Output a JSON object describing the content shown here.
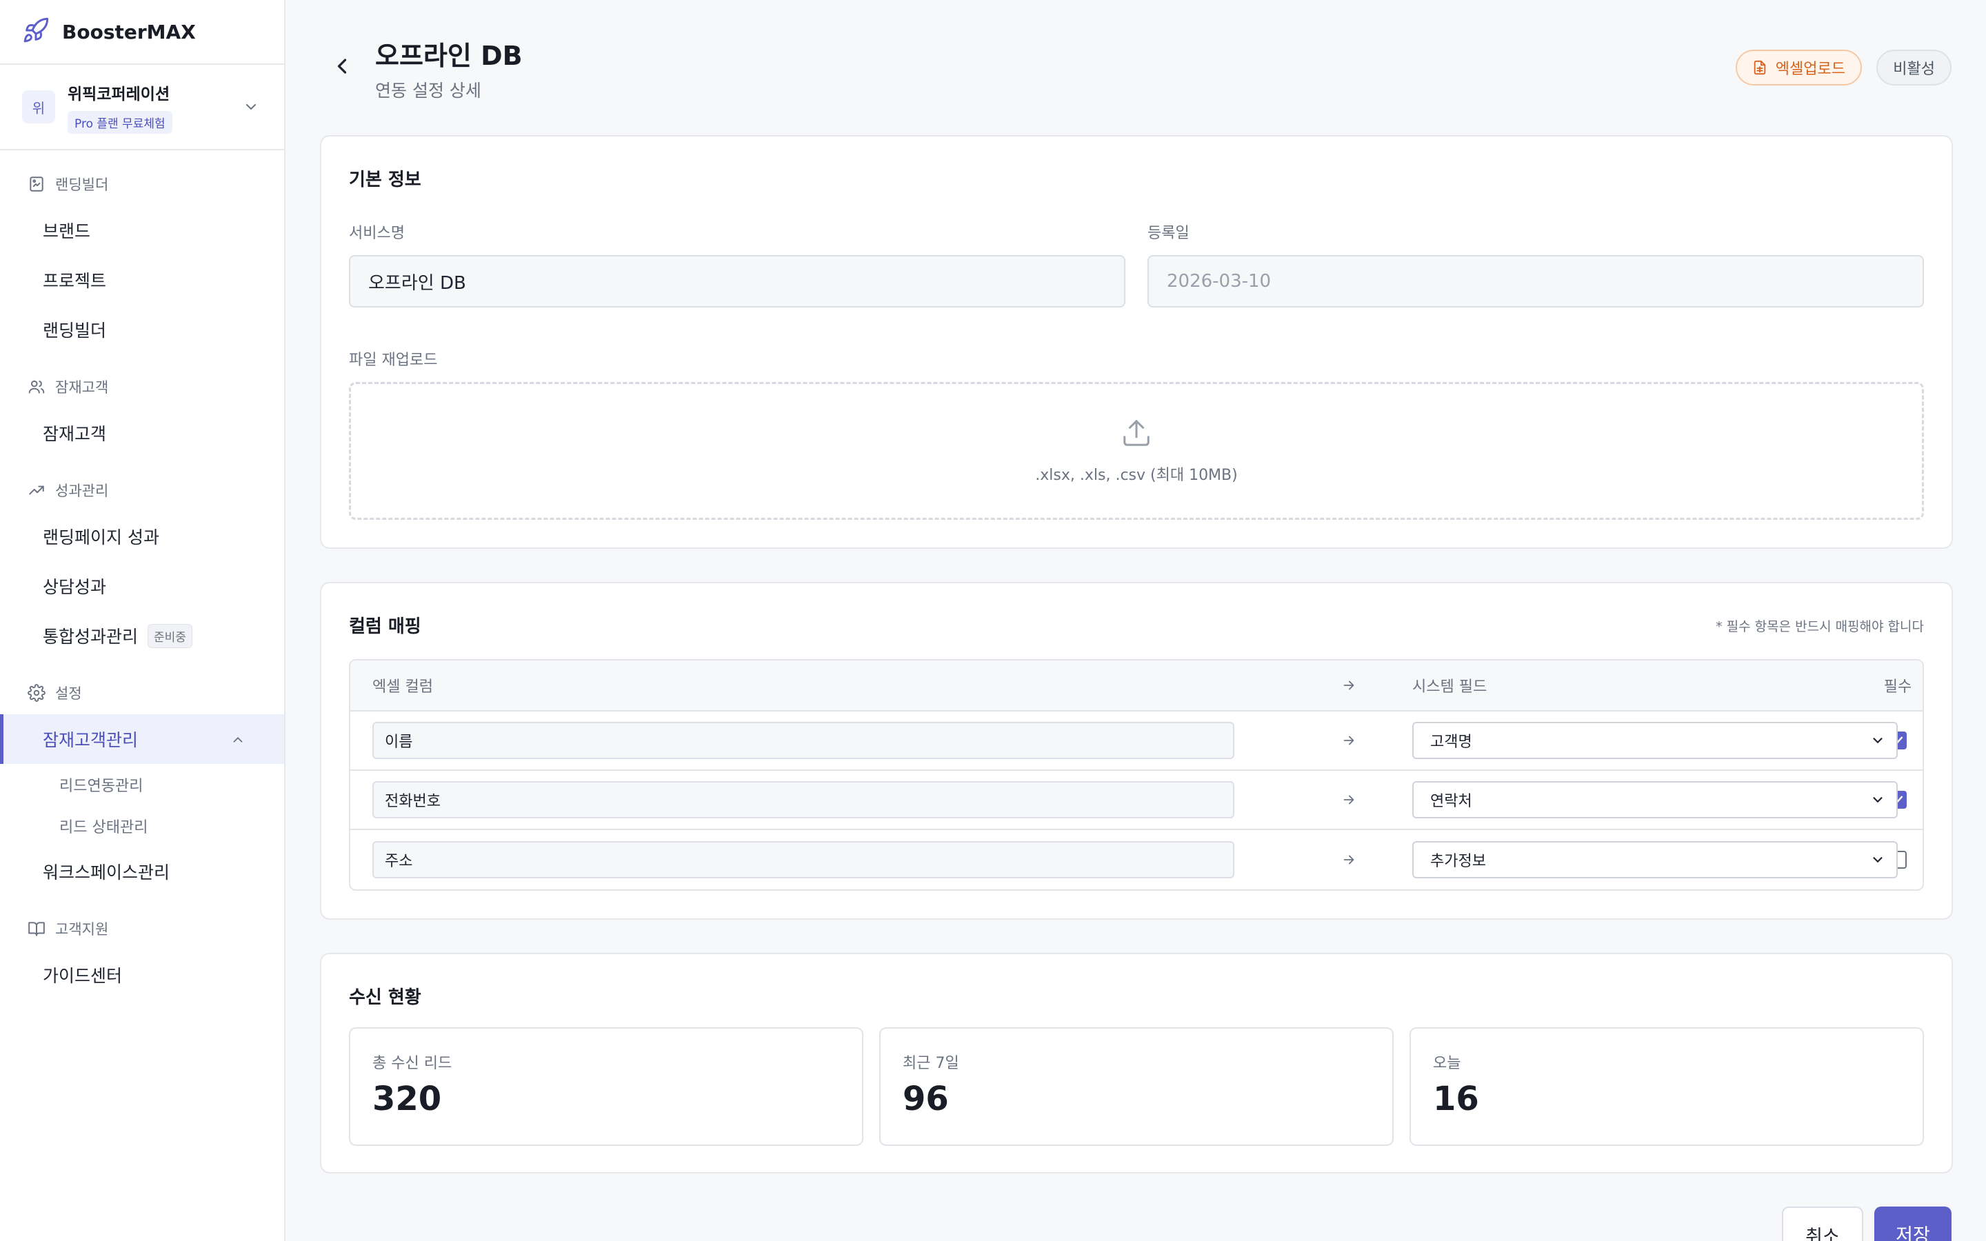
{
  "app": {
    "name": "BoosterMAX"
  },
  "org": {
    "avatar": "위",
    "name": "위픽코퍼레이션",
    "plan": "Pro 플랜 무료체험"
  },
  "sidebar": {
    "sections": [
      {
        "label": "랜딩빌더",
        "icon": "landing-icon"
      },
      {
        "label": "잠재고객",
        "icon": "users-icon"
      },
      {
        "label": "성과관리",
        "icon": "trend-icon"
      },
      {
        "label": "설정",
        "icon": "gear-icon"
      },
      {
        "label": "고객지원",
        "icon": "book-icon"
      }
    ],
    "items": {
      "brand": "브랜드",
      "project": "프로젝트",
      "landing": "랜딩빌더",
      "prospect": "잠재고객",
      "landing_perf": "랜딩페이지 성과",
      "consult_perf": "상담성과",
      "integrated_perf": "통합성과관리",
      "integrated_badge": "준비중",
      "prospect_mgmt": "잠재고객관리",
      "lead_link": "리드연동관리",
      "lead_status": "리드 상태관리",
      "workspace": "워크스페이스관리",
      "guide": "가이드센터"
    }
  },
  "header": {
    "title": "오프라인 DB",
    "subtitle": "연동 설정 상세",
    "excel_upload": "엑셀업로드",
    "inactive": "비활성"
  },
  "basic": {
    "title": "기본 정보",
    "service_label": "서비스명",
    "service_value": "오프라인 DB",
    "date_label": "등록일",
    "date_value": "2026-03-10",
    "reupload_label": "파일 재업로드",
    "upload_hint": ".xlsx, .xls, .csv (최대 10MB)"
  },
  "mapping": {
    "title": "컬럼 매핑",
    "note": "* 필수 항목은 반드시 매핑해야 합니다",
    "head_excel": "엑셀 컬럼",
    "head_system": "시스템 필드",
    "head_required": "필수",
    "rows": [
      {
        "excel": "이름",
        "system": "고객명",
        "required": true
      },
      {
        "excel": "전화번호",
        "system": "연락처",
        "required": true
      },
      {
        "excel": "주소",
        "system": "추가정보",
        "required": false
      }
    ]
  },
  "stats": {
    "title": "수신 현황",
    "items": [
      {
        "label": "총 수신 리드",
        "value": "320"
      },
      {
        "label": "최근 7일",
        "value": "96"
      },
      {
        "label": "오늘",
        "value": "16"
      }
    ]
  },
  "footer": {
    "cancel": "취소",
    "save": "저장"
  },
  "colors": {
    "accent": "#5b5fc7",
    "excel": "#d9621c"
  }
}
